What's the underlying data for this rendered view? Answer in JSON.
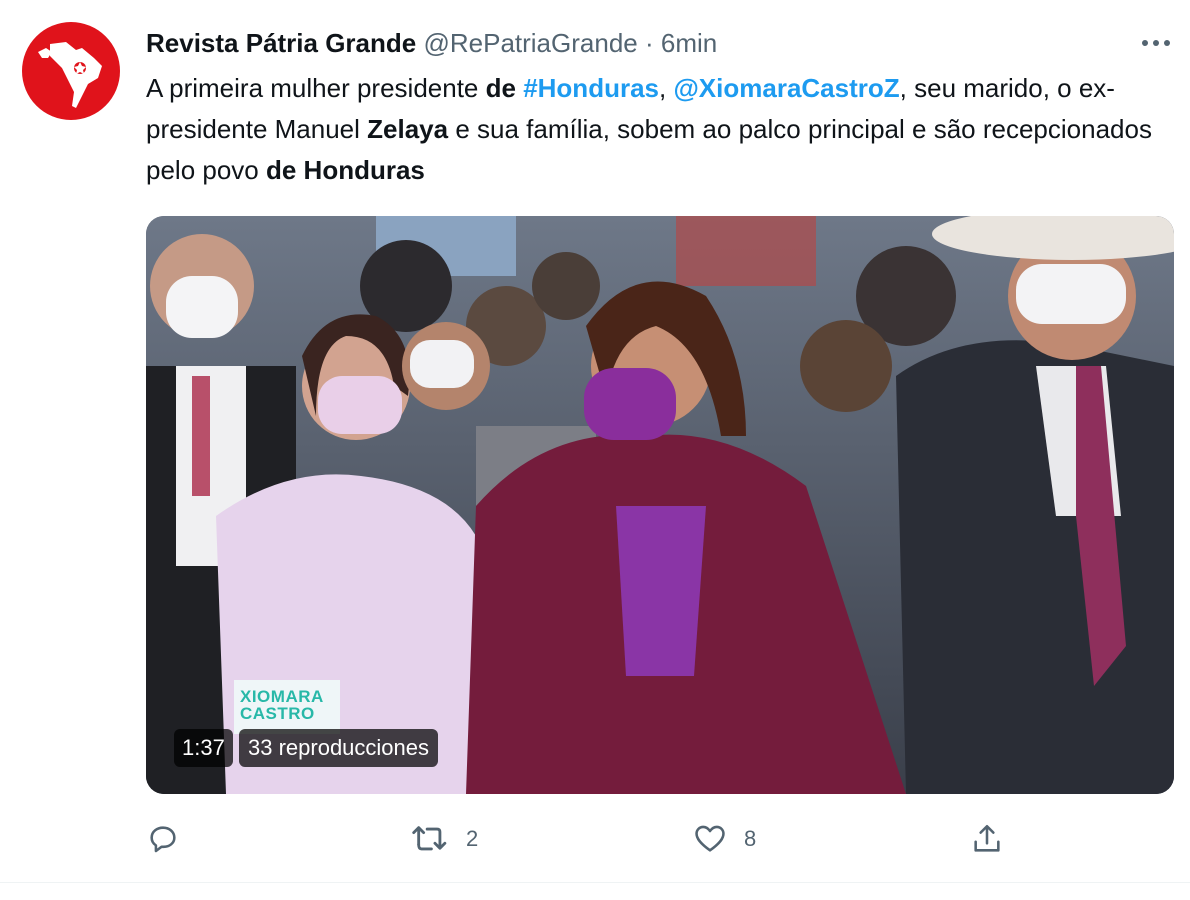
{
  "tweet": {
    "author_name": "Revista Pátria Grande",
    "author_handle": "@RePatriaGrande",
    "separator": "·",
    "time": "6min",
    "text": {
      "t1": "A primeira mulher presidente ",
      "t2": "de",
      "t3": " ",
      "t4": "#Honduras",
      "t5": ", ",
      "t6": "@XiomaraCastroZ",
      "t7": ", seu marido, o ex-presidente Manuel ",
      "t8": "Zelaya",
      "t9": " e sua família, sobem ao palco principal e são recepcionados pelo povo ",
      "t10": "de Honduras"
    },
    "media": {
      "duration": "1:37",
      "views": "33 reproducciones",
      "lower_third_lines": [
        "XIOMARA",
        "CASTRO"
      ]
    },
    "actions": {
      "reply_count": "",
      "retweet_count": "2",
      "like_count": "8"
    }
  },
  "icons": {
    "avatar": "latin-america-map-icon",
    "more": "more-horizontal-icon",
    "reply": "reply-icon",
    "retweet": "retweet-icon",
    "like": "heart-icon",
    "share": "share-icon"
  },
  "colors": {
    "link": "#1d9bf0",
    "avatar_bg": "#e0131b",
    "secondary_text": "#536471"
  }
}
